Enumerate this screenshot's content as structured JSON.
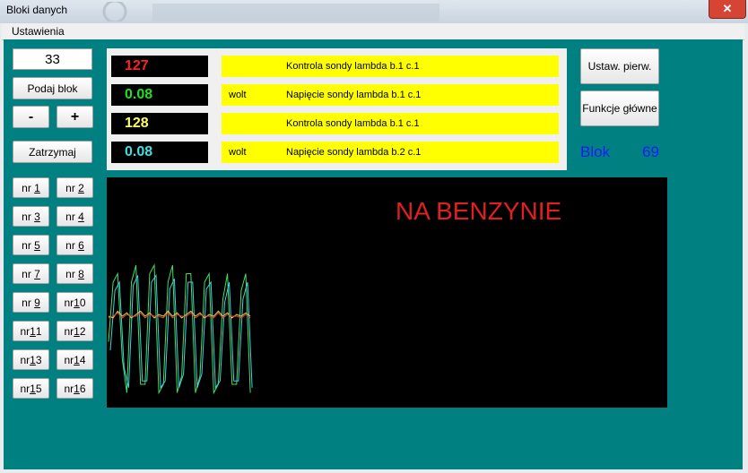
{
  "window": {
    "title": "Bloki danych",
    "close_label": "✕"
  },
  "menu": {
    "items": [
      "Ustawienia"
    ]
  },
  "left": {
    "block_number": "33",
    "fetch_label": "Podaj blok",
    "minus_label": "-",
    "plus_label": "+",
    "stop_label": "Zatrzymaj",
    "nr_buttons": [
      {
        "pre": "nr ",
        "u": "1",
        "post": ""
      },
      {
        "pre": "nr ",
        "u": "2",
        "post": ""
      },
      {
        "pre": "nr ",
        "u": "3",
        "post": ""
      },
      {
        "pre": "nr ",
        "u": "4",
        "post": ""
      },
      {
        "pre": "nr ",
        "u": "5",
        "post": ""
      },
      {
        "pre": "nr ",
        "u": "6",
        "post": ""
      },
      {
        "pre": "nr ",
        "u": "7",
        "post": ""
      },
      {
        "pre": "nr ",
        "u": "8",
        "post": ""
      },
      {
        "pre": "nr ",
        "u": "9",
        "post": ""
      },
      {
        "pre": "nr",
        "u": "1",
        "post": "0"
      },
      {
        "pre": "nr",
        "u": "1",
        "post": "1"
      },
      {
        "pre": "nr",
        "u": "1",
        "post": "2"
      },
      {
        "pre": "nr",
        "u": "1",
        "post": "3"
      },
      {
        "pre": "nr",
        "u": "1",
        "post": "4"
      },
      {
        "pre": "nr",
        "u": "1",
        "post": "5"
      },
      {
        "pre": "nr",
        "u": "1",
        "post": "6"
      }
    ]
  },
  "readings": [
    {
      "value": "127",
      "color": "#ff2020",
      "unit": "",
      "label": "Kontrola sondy lambda b.1 c.1"
    },
    {
      "value": "0.08",
      "color": "#20e020",
      "unit": "wolt",
      "label": "Napięcie sondy lambda b.1 c.1"
    },
    {
      "value": "128",
      "color": "#ffff60",
      "unit": "",
      "label": "Kontrola sondy lambda b.1 c.1"
    },
    {
      "value": "0.08",
      "color": "#40e0e0",
      "unit": "wolt",
      "label": "Napięcie sondy lambda b.2 c.1"
    }
  ],
  "right": {
    "basic_settings_label": "Ustaw. pierw.",
    "main_functions_label": "Funkcje główne",
    "blok_label": "Blok",
    "blok_value": "69"
  },
  "graph": {
    "annotation": "NA BENZYNIE",
    "colors": {
      "green": "#40e060",
      "yellow": "#e0d040",
      "red": "#e04040"
    }
  },
  "chart_data": {
    "type": "line",
    "title": "",
    "annotations": [
      "NA BENZYNIE"
    ],
    "ylim": [
      0,
      1
    ],
    "series": [
      {
        "name": "",
        "color": "green",
        "values": [
          0.35,
          0.7,
          0.75,
          0.25,
          0.05,
          0.7,
          0.8,
          0.1,
          0.1,
          0.75,
          0.8,
          0.05,
          0.1,
          0.7,
          0.8,
          0.05,
          0.15,
          0.75,
          0.75,
          0.05,
          0.15,
          0.7,
          0.75,
          0.05,
          0.1,
          0.6,
          0.75,
          0.1,
          0.1,
          0.65,
          0.75,
          0.05
        ]
      },
      {
        "name": "",
        "color": "cyan",
        "values": [
          0.3,
          0.65,
          0.7,
          0.2,
          0.08,
          0.68,
          0.74,
          0.12,
          0.12,
          0.7,
          0.74,
          0.08,
          0.12,
          0.66,
          0.72,
          0.08,
          0.16,
          0.7,
          0.7,
          0.08,
          0.16,
          0.66,
          0.7,
          0.08,
          0.12,
          0.58,
          0.7,
          0.12,
          0.12,
          0.6,
          0.7,
          0.08
        ]
      },
      {
        "name": "",
        "color": "yellow",
        "values": [
          0.5,
          0.49,
          0.53,
          0.5,
          0.52,
          0.49,
          0.51,
          0.53,
          0.5,
          0.52,
          0.49,
          0.51,
          0.5,
          0.53,
          0.5,
          0.52,
          0.49,
          0.51,
          0.53,
          0.5,
          0.52,
          0.49,
          0.51,
          0.5,
          0.53,
          0.5,
          0.52,
          0.49,
          0.51,
          0.5,
          0.52,
          0.5
        ]
      },
      {
        "name": "",
        "color": "red",
        "values": [
          0.49,
          0.5,
          0.52,
          0.49,
          0.51,
          0.5,
          0.5,
          0.52,
          0.49,
          0.51,
          0.5,
          0.5,
          0.49,
          0.52,
          0.49,
          0.51,
          0.5,
          0.5,
          0.52,
          0.49,
          0.51,
          0.5,
          0.5,
          0.49,
          0.52,
          0.49,
          0.51,
          0.5,
          0.5,
          0.49,
          0.51,
          0.49
        ]
      }
    ]
  }
}
